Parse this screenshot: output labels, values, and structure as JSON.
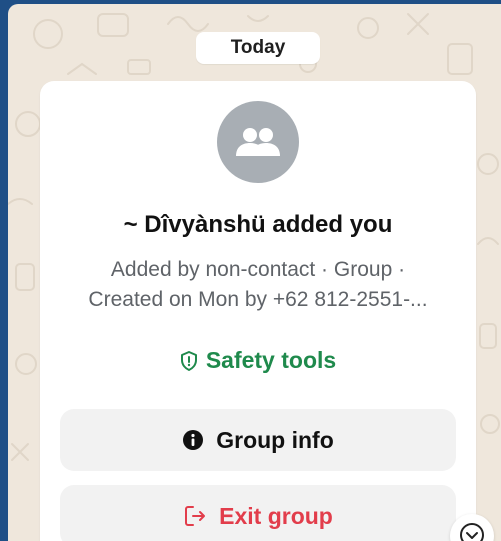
{
  "chat": {
    "date_label": "Today"
  },
  "system_card": {
    "avatar_icon": "group-icon",
    "title": "~ Dîvyànshü added you",
    "subtitle_line1": "Added by non-contact · Group ·",
    "subtitle_line2": "Created on Mon by +62 812-2551-...",
    "safety_label": "Safety tools",
    "safety_icon": "shield-icon",
    "group_info_label": "Group info",
    "group_info_icon": "info-icon",
    "exit_label": "Exit group",
    "exit_icon": "exit-icon"
  },
  "scroll_down_icon": "chevron-down-icon",
  "colors": {
    "safety_green": "#1f8a4c",
    "exit_red": "#e23d4b",
    "avatar_gray": "#a8aeb4",
    "wallpaper": "#efe7dc",
    "outer_blue": "#1f4f86"
  }
}
